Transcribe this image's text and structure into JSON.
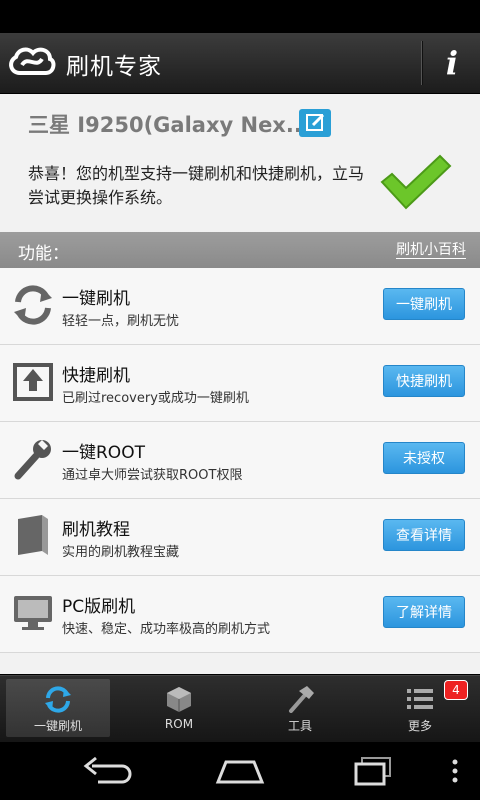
{
  "header": {
    "title": "刷机专家",
    "info_label": "i"
  },
  "device": {
    "name": "三星 I9250(Galaxy Nex..."
  },
  "support_message": "恭喜！您的机型支持一键刷机和快捷刷机，立马尝试更换操作系统。",
  "section": {
    "title": "功能：",
    "link": "刷机小百科"
  },
  "features": [
    {
      "title": "一键刷机",
      "subtitle": "轻轻一点，刷机无忧",
      "button": "一键刷机",
      "icon": "refresh-arrows-icon"
    },
    {
      "title": "快捷刷机",
      "subtitle": "已刷过recovery或成功一键刷机",
      "button": "快捷刷机",
      "icon": "upload-tray-icon"
    },
    {
      "title": "一键ROOT",
      "subtitle": "通过卓大师尝试获取ROOT权限",
      "button": "未授权",
      "icon": "wrench-icon"
    },
    {
      "title": "刷机教程",
      "subtitle": "实用的刷机教程宝藏",
      "button": "查看详情",
      "icon": "book-icon"
    },
    {
      "title": "PC版刷机",
      "subtitle": "快速、稳定、成功率极高的刷机方式",
      "button": "了解详情",
      "icon": "monitor-icon"
    }
  ],
  "tabs": [
    {
      "label": "一键刷机",
      "icon": "sync-icon",
      "active": true
    },
    {
      "label": "ROM",
      "icon": "cube-icon",
      "active": false
    },
    {
      "label": "工具",
      "icon": "hammer-icon",
      "active": false
    },
    {
      "label": "更多",
      "icon": "list-icon",
      "active": false,
      "badge": "4"
    }
  ],
  "colors": {
    "accent": "#2c95de",
    "check": "#6cc62a",
    "badge": "#e22222"
  }
}
